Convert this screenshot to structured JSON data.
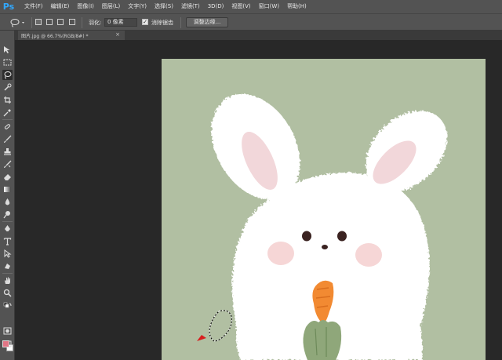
{
  "app": {
    "logo": "Ps"
  },
  "menu": [
    "文件(F)",
    "编辑(E)",
    "图像(I)",
    "图层(L)",
    "文字(Y)",
    "选择(S)",
    "滤镜(T)",
    "3D(D)",
    "视图(V)",
    "窗口(W)",
    "帮助(H)"
  ],
  "options": {
    "feather_label": "羽化:",
    "feather_value": "0 像素",
    "antialias_label": "消除锯齿",
    "antialias_checked": "✓",
    "refine_label": "调整边缘..."
  },
  "document": {
    "tab_title": "图片.jpg @ 66.7%(RGB/8#) *",
    "close_glyph": "×"
  },
  "colors": {
    "foreground": "#e07585",
    "background": "#ffffff",
    "canvas_bg": "#b1bfa2",
    "selection_arrow": "#d81e1e"
  },
  "tools": [
    "move-tool",
    "marquee-tool",
    "lasso-tool",
    "quick-select-tool",
    "crop-tool",
    "eyedropper-tool",
    "healing-brush-tool",
    "brush-tool",
    "clone-stamp-tool",
    "history-brush-tool",
    "eraser-tool",
    "gradient-tool",
    "blur-tool",
    "dodge-tool",
    "pen-tool",
    "type-tool",
    "path-select-tool",
    "shape-tool",
    "hand-tool",
    "zoom-tool"
  ],
  "canvas_content": {
    "subject": "bunny-holding-carrot",
    "selection": "lasso-marching-ants"
  }
}
